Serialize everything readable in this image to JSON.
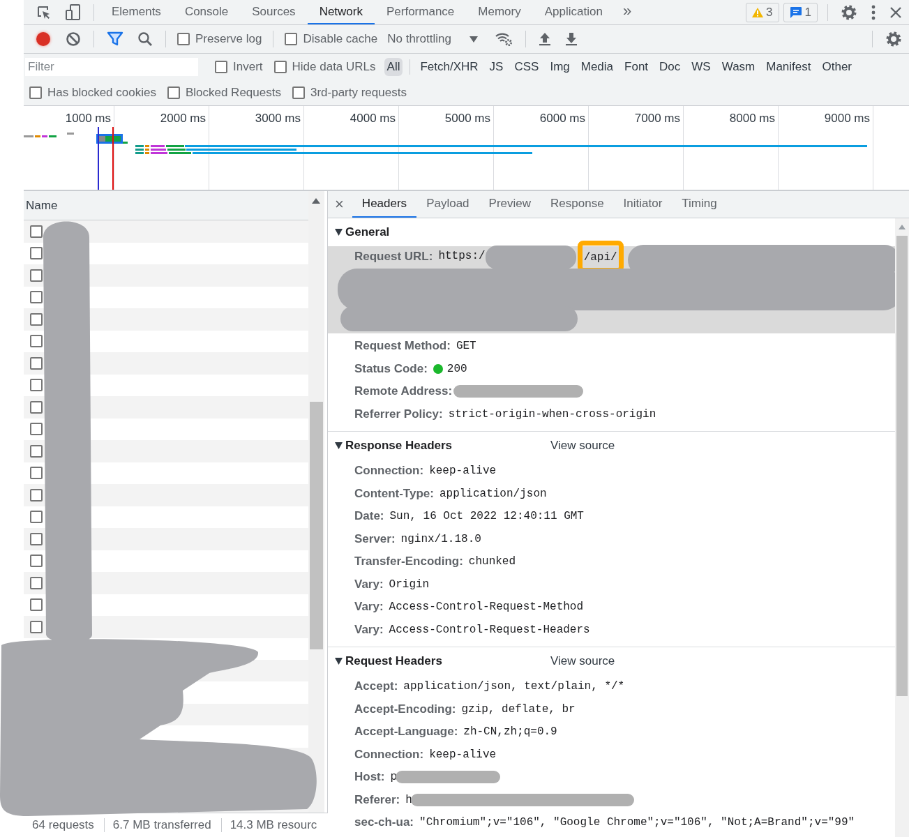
{
  "top_tabs": [
    {
      "label": "Elements",
      "selected": false
    },
    {
      "label": "Console",
      "selected": false
    },
    {
      "label": "Sources",
      "selected": false
    },
    {
      "label": "Network",
      "selected": true
    },
    {
      "label": "Performance",
      "selected": false
    },
    {
      "label": "Memory",
      "selected": false
    },
    {
      "label": "Application",
      "selected": false
    }
  ],
  "more_tabs": "»",
  "warnings": "3",
  "messages": "1",
  "toolbar": {
    "recording": true,
    "filter_on": true,
    "preserve_log": {
      "label": "Preserve log",
      "checked": false
    },
    "disable_cache": {
      "label": "Disable cache",
      "checked": false
    },
    "throttling": "No throttling"
  },
  "filter": {
    "placeholder": "Filter",
    "invert": {
      "label": "Invert",
      "checked": false
    },
    "hide_data_urls": {
      "label": "Hide data URLs",
      "checked": false
    },
    "types": [
      {
        "label": "All",
        "selected": true
      },
      {
        "label": "Fetch/XHR",
        "selected": false
      },
      {
        "label": "JS",
        "selected": false
      },
      {
        "label": "CSS",
        "selected": false
      },
      {
        "label": "Img",
        "selected": false
      },
      {
        "label": "Media",
        "selected": false
      },
      {
        "label": "Font",
        "selected": false
      },
      {
        "label": "Doc",
        "selected": false
      },
      {
        "label": "WS",
        "selected": false
      },
      {
        "label": "Wasm",
        "selected": false
      },
      {
        "label": "Manifest",
        "selected": false
      },
      {
        "label": "Other",
        "selected": false
      }
    ]
  },
  "more_filters": [
    {
      "label": "Has blocked cookies",
      "checked": false
    },
    {
      "label": "Blocked Requests",
      "checked": false
    },
    {
      "label": "3rd-party requests",
      "checked": false
    }
  ],
  "overview": {
    "ticks": [
      "1000 ms",
      "2000 ms",
      "3000 ms",
      "4000 ms",
      "5000 ms",
      "6000 ms",
      "7000 ms",
      "8000 ms",
      "9000 ms"
    ]
  },
  "requests": {
    "column": "Name",
    "rows": [
      {
        "checked": false
      },
      {
        "checked": false
      },
      {
        "checked": false
      },
      {
        "checked": false
      },
      {
        "checked": false
      },
      {
        "checked": false
      },
      {
        "checked": false
      },
      {
        "checked": false
      },
      {
        "checked": false
      },
      {
        "checked": false
      },
      {
        "checked": false
      },
      {
        "checked": false
      },
      {
        "checked": false
      },
      {
        "checked": false
      },
      {
        "checked": false
      },
      {
        "checked": false
      },
      {
        "checked": false
      },
      {
        "checked": false
      },
      {
        "checked": false
      }
    ]
  },
  "status_bar": [
    "64 requests",
    "6.7 MB transferred",
    "14.3 MB resourc"
  ],
  "details": {
    "close": "×",
    "tabs": [
      {
        "label": "Headers",
        "selected": true
      },
      {
        "label": "Payload",
        "selected": false
      },
      {
        "label": "Preview",
        "selected": false
      },
      {
        "label": "Response",
        "selected": false
      },
      {
        "label": "Initiator",
        "selected": false
      },
      {
        "label": "Timing",
        "selected": false
      }
    ],
    "sections": [
      {
        "title": "General",
        "expanded": true,
        "rows": [
          {
            "kind": "url",
            "key": "Request URL:",
            "parts": [
              "https:/",
              "/api/"
            ]
          },
          {
            "kind": "text",
            "key": "Request Method:",
            "value": "GET"
          },
          {
            "kind": "status",
            "key": "Status Code:",
            "value": "200"
          },
          {
            "kind": "redacted",
            "key": "Remote Address:"
          },
          {
            "kind": "text",
            "key": "Referrer Policy:",
            "value": "strict-origin-when-cross-origin"
          }
        ]
      },
      {
        "title": "Response Headers",
        "expanded": true,
        "view_source": "View source",
        "rows": [
          {
            "kind": "text",
            "key": "Connection:",
            "value": "keep-alive"
          },
          {
            "kind": "text",
            "key": "Content-Type:",
            "value": "application/json"
          },
          {
            "kind": "text",
            "key": "Date:",
            "value": "Sun, 16 Oct 2022 12:40:11 GMT"
          },
          {
            "kind": "text",
            "key": "Server:",
            "value": "nginx/1.18.0"
          },
          {
            "kind": "text",
            "key": "Transfer-Encoding:",
            "value": "chunked"
          },
          {
            "kind": "text",
            "key": "Vary:",
            "value": "Origin"
          },
          {
            "kind": "text",
            "key": "Vary:",
            "value": "Access-Control-Request-Method"
          },
          {
            "kind": "text",
            "key": "Vary:",
            "value": "Access-Control-Request-Headers"
          }
        ]
      },
      {
        "title": "Request Headers",
        "expanded": true,
        "view_source": "View source",
        "rows": [
          {
            "kind": "text",
            "key": "Accept:",
            "value": "application/json, text/plain, */*"
          },
          {
            "kind": "text",
            "key": "Accept-Encoding:",
            "value": "gzip, deflate, br"
          },
          {
            "kind": "text",
            "key": "Accept-Language:",
            "value": "zh-CN,zh;q=0.9"
          },
          {
            "kind": "text",
            "key": "Connection:",
            "value": "keep-alive"
          },
          {
            "kind": "redacted",
            "key": "Host:",
            "value": "p"
          },
          {
            "kind": "redacted",
            "key": "Referer:",
            "value": "h"
          },
          {
            "kind": "text",
            "key": "sec-ch-ua:",
            "value": "\"Chromium\";v=\"106\", \"Google Chrome\";v=\"106\", \"Not;A=Brand\";v=\"99\""
          }
        ]
      }
    ]
  }
}
